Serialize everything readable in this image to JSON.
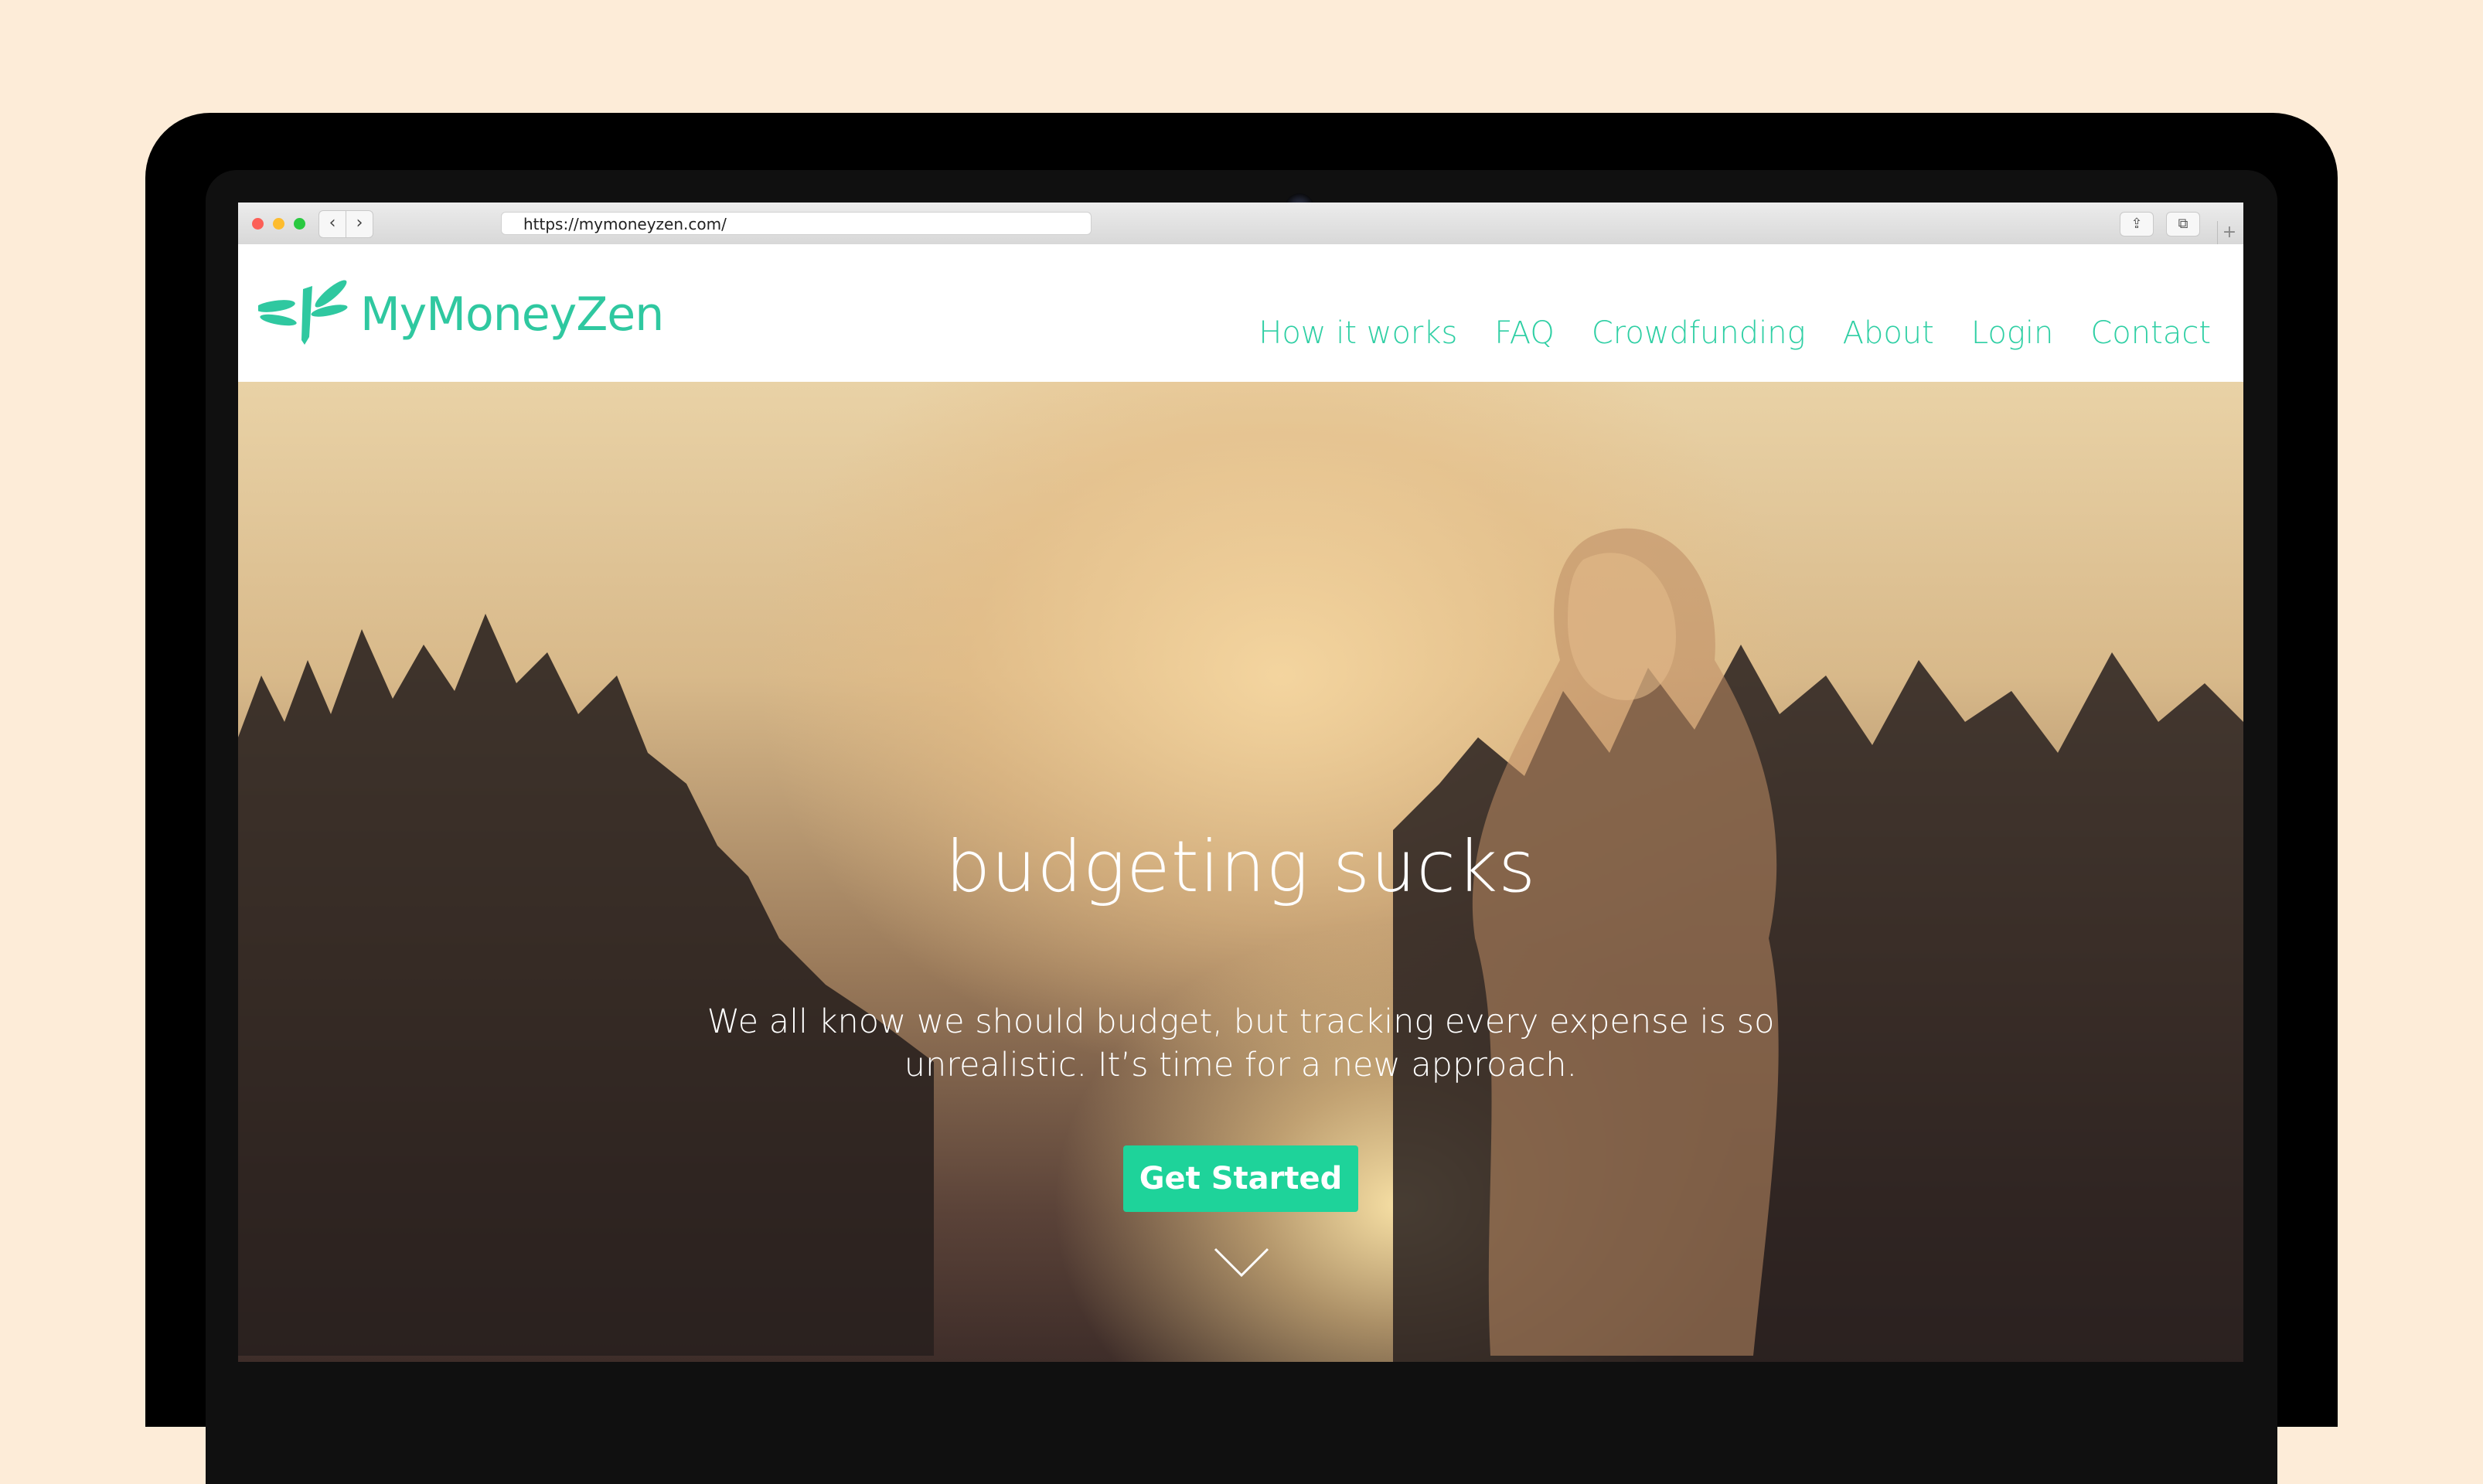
{
  "browser": {
    "url": "https://mymoneyzen.com/",
    "back_glyph": "‹",
    "forward_glyph": "›",
    "share_glyph": "⇪",
    "tabs_glyph": "⧉",
    "new_tab_glyph": "+"
  },
  "site": {
    "brand": "MyMoneyZen",
    "accent_color": "#2fc8a0",
    "cta_color": "#1ed39a",
    "nav": [
      "How it works",
      "FAQ",
      "Crowdfunding",
      "About",
      "Login",
      "Contact"
    ]
  },
  "hero": {
    "title": "budgeting sucks",
    "subtitle": "We all know we should budget, but tracking every expense is so unrealistic. It’s time for a new approach.",
    "cta_label": "Get Started",
    "scroll_icon": "chevron-down-icon"
  },
  "icons": {
    "logo": "dragonfly-icon",
    "camera": "webcam-icon"
  }
}
